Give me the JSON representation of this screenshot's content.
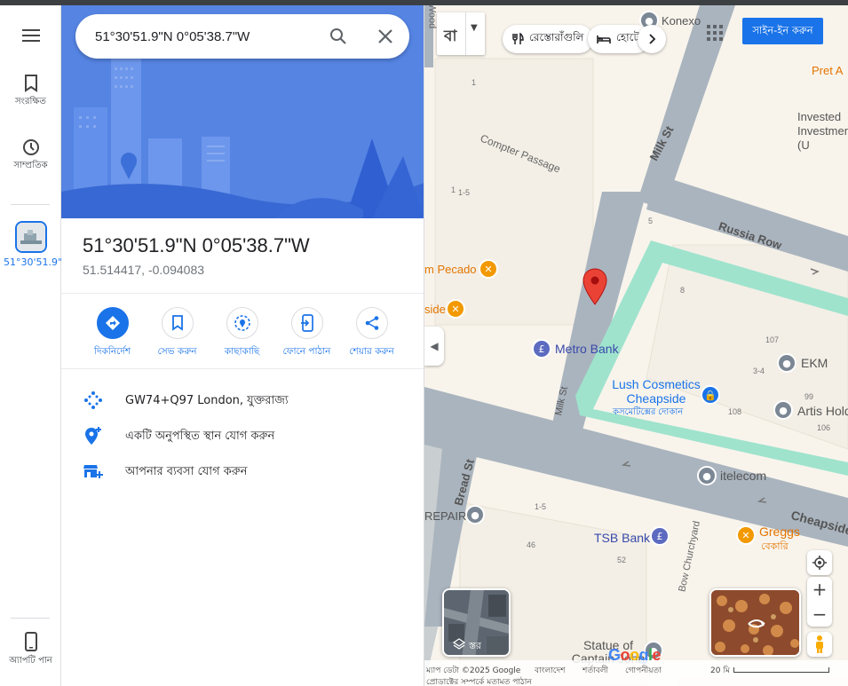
{
  "rail": {
    "saved_label": "সংরক্ষিত",
    "recent_label": "সাম্প্রতিক",
    "recent_place_label": "51°30'51.9\"N…",
    "get_app_label": "অ্যাপটি পান"
  },
  "search": {
    "value": "51°30'51.9\"N 0°05'38.7\"W"
  },
  "place": {
    "title": "51°30'51.9\"N 0°05'38.7\"W",
    "decimal_coords": "51.514417, -0.094083"
  },
  "actions": [
    {
      "label": "দিকনির্দেশ",
      "icon": "directions-icon"
    },
    {
      "label": "সেভ করুন",
      "icon": "bookmark-icon"
    },
    {
      "label": "কাছাকাছি",
      "icon": "nearby-icon"
    },
    {
      "label": "ফোনে পাঠান",
      "icon": "send-to-phone-icon"
    },
    {
      "label": "শেয়ার করুন",
      "icon": "share-icon"
    }
  ],
  "info": {
    "plus_code": "GW74+Q97 London, যুক্তরাজ্য",
    "add_missing_place": "একটি অনুপস্থিত স্থান যোগ করুন",
    "add_business": "আপনার ব্যবসা যোগ করুন"
  },
  "map": {
    "lang_button": "বা",
    "chips": [
      {
        "label": "রেস্তোরাঁগুলি",
        "icon": "restaurant-icon"
      },
      {
        "label": "হোটেল",
        "icon": "hotel-icon"
      }
    ],
    "signin_label": "সাইন-ইন করুন",
    "layers_label": "স্তর",
    "streets": [
      "Milk St",
      "Russia Row",
      "Compter Passage",
      "Bread St",
      "Cheapside",
      "Bow Churchyard",
      "Wood"
    ],
    "places": [
      {
        "name": "Konexo",
        "type": "business"
      },
      {
        "name": "Pret A",
        "type": "food"
      },
      {
        "name": "Invested Investment (U",
        "type": "business"
      },
      {
        "name": "m Pecado",
        "type": "food"
      },
      {
        "name": "side",
        "type": "food"
      },
      {
        "name": "Metro Bank",
        "type": "bank"
      },
      {
        "name": "EKM",
        "type": "business"
      },
      {
        "name": "Lush Cosmetics Cheapside",
        "sub": "কসমেটিক্সের দোকান",
        "type": "shop"
      },
      {
        "name": "Artis Hold",
        "type": "business"
      },
      {
        "name": "itelecom",
        "type": "business"
      },
      {
        "name": "REPAIR",
        "type": "business"
      },
      {
        "name": "TSB Bank",
        "type": "bank"
      },
      {
        "name": "Greggs",
        "sub": "বেকারি",
        "type": "food"
      },
      {
        "name": "Statue of Captain John",
        "type": "landmark"
      }
    ],
    "building_numbers": [
      "1",
      "1-5",
      "1",
      "5",
      "8",
      "107",
      "3-4",
      "99",
      "108",
      "106",
      "1-5",
      "46",
      "52"
    ],
    "footer": {
      "data": "ম্যাপ ডেটা ©2025 Google",
      "country": "বাংলাদেশ",
      "terms": "শর্তাবলী",
      "privacy": "গোপনীয়তা",
      "feedback": "প্রোডাক্টের সম্পর্কে মতামত পাঠান",
      "scale": "20 মি"
    },
    "logo": "Google"
  }
}
